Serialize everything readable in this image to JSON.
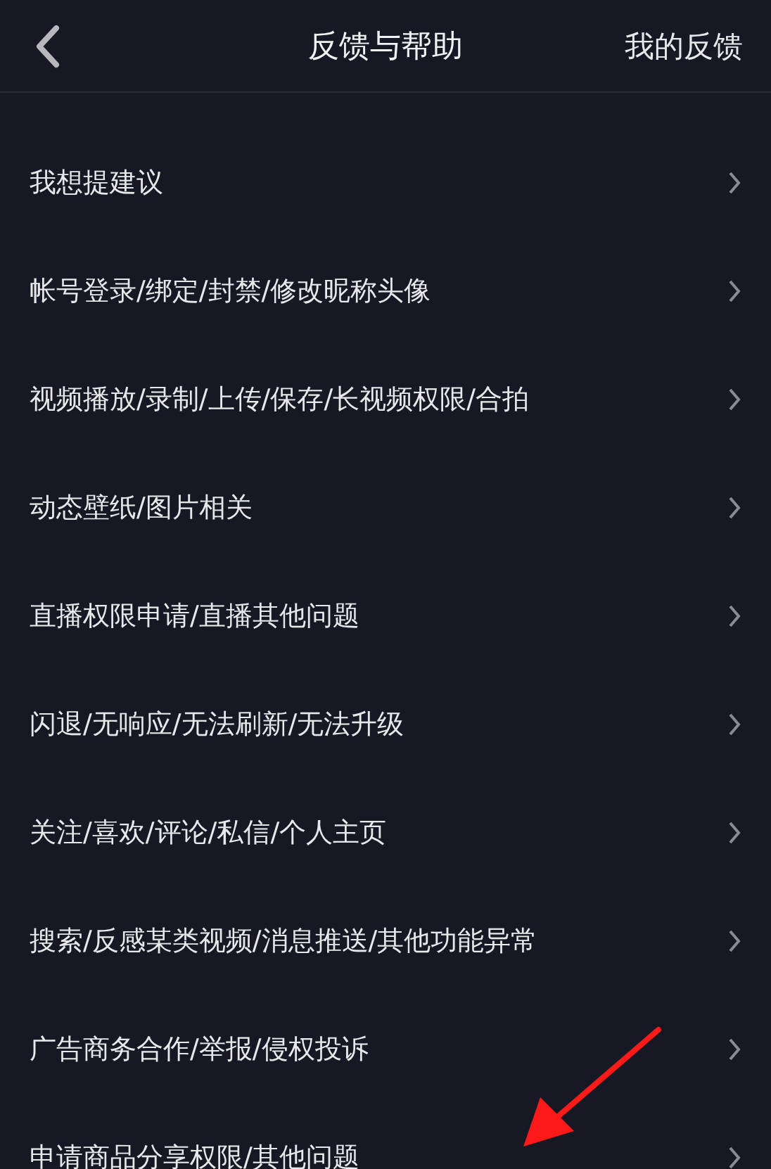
{
  "header": {
    "title": "反馈与帮助",
    "action": "我的反馈"
  },
  "items": [
    {
      "label": "我想提建议"
    },
    {
      "label": "帐号登录/绑定/封禁/修改昵称头像"
    },
    {
      "label": "视频播放/录制/上传/保存/长视频权限/合拍"
    },
    {
      "label": "动态壁纸/图片相关"
    },
    {
      "label": "直播权限申请/直播其他问题"
    },
    {
      "label": "闪退/无响应/无法刷新/无法升级"
    },
    {
      "label": "关注/喜欢/评论/私信/个人主页"
    },
    {
      "label": "搜索/反感某类视频/消息推送/其他功能异常"
    },
    {
      "label": "广告商务合作/举报/侵权投诉"
    },
    {
      "label": "申请商品分享权限/其他问题"
    }
  ]
}
